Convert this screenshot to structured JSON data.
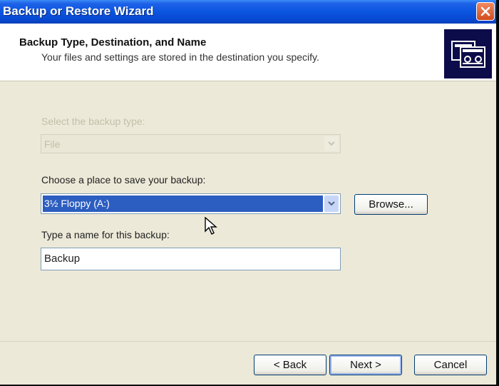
{
  "window": {
    "title": "Backup or Restore Wizard",
    "close_icon": "close-icon"
  },
  "header": {
    "title": "Backup Type, Destination, and Name",
    "subtitle": "Your files and settings are stored in the destination you specify.",
    "icon": "backup-tapes-icon"
  },
  "form": {
    "backup_type": {
      "label": "Select the backup type:",
      "value": "File",
      "enabled": false
    },
    "destination": {
      "label": "Choose a place to save your backup:",
      "value": "3½ Floppy (A:)",
      "browse_label": "Browse..."
    },
    "name": {
      "label": "Type a name for this backup:",
      "value": "Backup"
    }
  },
  "footer": {
    "back_label": "< Back",
    "next_label": "Next >",
    "cancel_label": "Cancel"
  }
}
